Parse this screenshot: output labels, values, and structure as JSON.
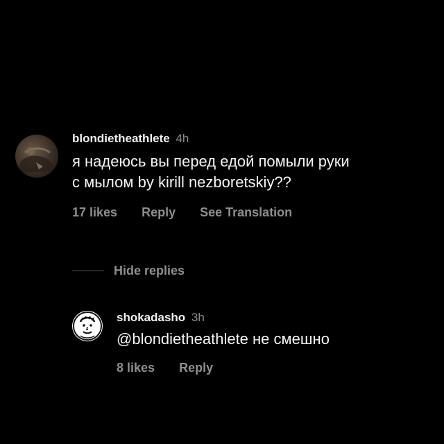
{
  "comment": {
    "username": "blondietheathlete",
    "time": "4h",
    "text_line1": "я надеюсь вы перед едой помыли руки",
    "text_line2": "с мылом by kirill nezboretskiy??",
    "likes": "17 likes",
    "reply": "Reply",
    "see_translation": "See Translation",
    "avatar_icon": "user-photo-avatar"
  },
  "replies_toggle": {
    "label": "Hide replies"
  },
  "reply_comment": {
    "username": "shokadasho",
    "time": "3h",
    "text": "@blondietheathlete не смешно",
    "likes": "8 likes",
    "reply": "Reply",
    "avatar_icon": "cartoon-face-avatar"
  },
  "colors": {
    "background": "#000000",
    "primary_text": "#f5f5f5",
    "secondary_text": "#8e8e8e"
  }
}
